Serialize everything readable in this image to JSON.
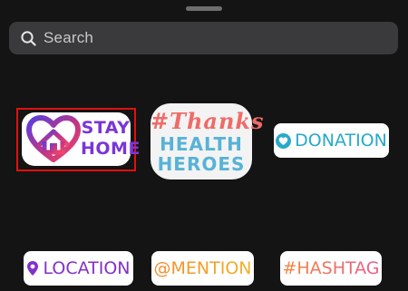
{
  "search": {
    "placeholder": "Search",
    "icon": "search-icon"
  },
  "stickers": {
    "stay_home": {
      "line1": "STAY",
      "line2": "HOME",
      "icon": "heart-house-icon",
      "selected": true,
      "selection_color": "#e01010"
    },
    "thanks": {
      "line1": "#Thanks",
      "line2": "HEALTH",
      "line3": "HEROES"
    },
    "donation": {
      "label": "DONATION",
      "icon": "heart-circle-icon",
      "color": "#28a9c9"
    },
    "location": {
      "label": "LOCATION",
      "icon": "location-pin-icon",
      "color": "#8231c9"
    },
    "mention": {
      "label": "@MENTION",
      "color": "#f29d25"
    },
    "hashtag": {
      "label": "#HASHTAG",
      "color": "#f07b56"
    }
  }
}
